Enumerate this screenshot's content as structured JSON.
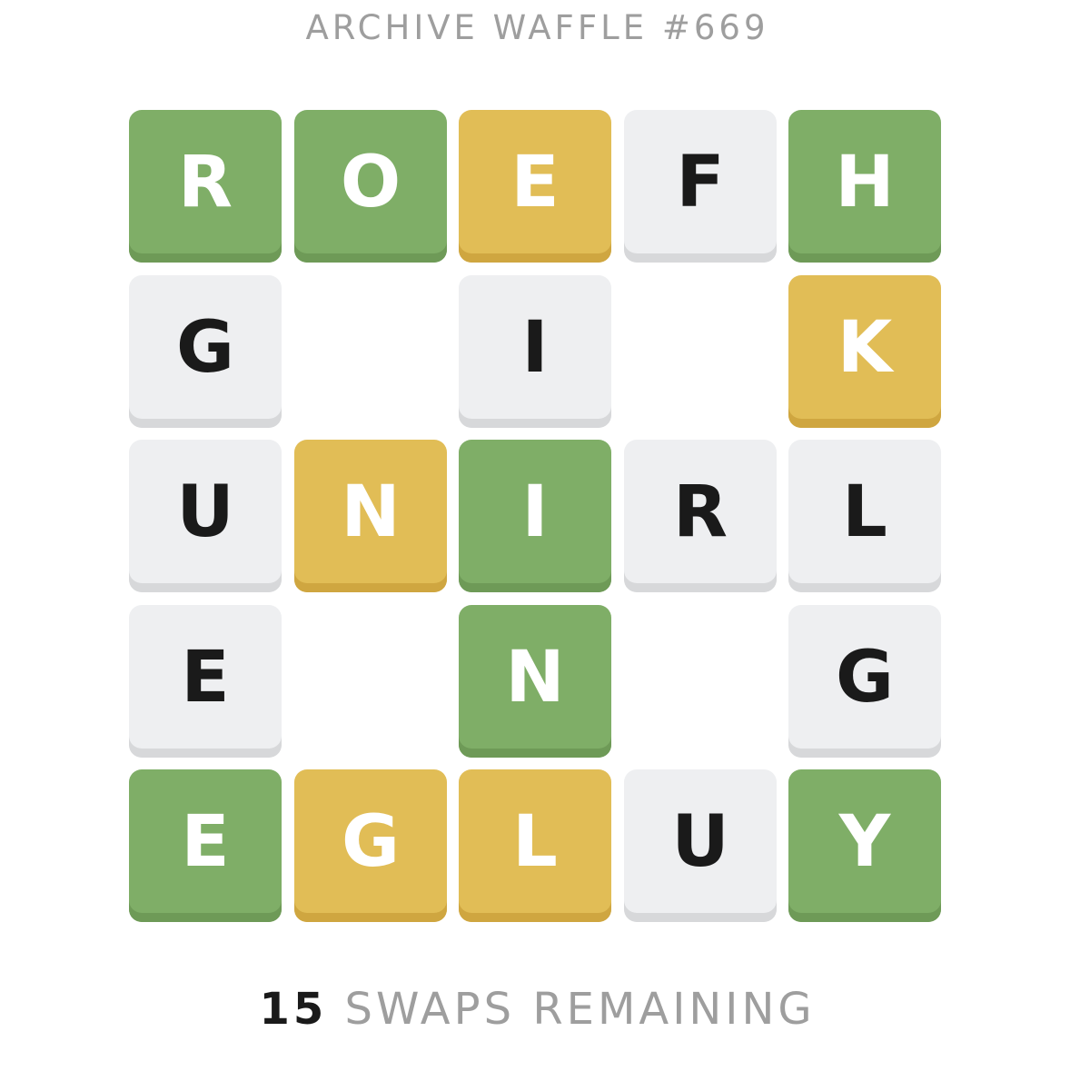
{
  "header": {
    "title": "ARCHIVE WAFFLE #669"
  },
  "colors": {
    "green": "#7fae67",
    "yellow": "#e1bd56",
    "grey": "#eeeff1",
    "dark_text": "#1a1a1a",
    "muted_text": "#9e9e9e"
  },
  "grid": {
    "rows": 5,
    "cols": 5,
    "tiles": [
      {
        "row": 0,
        "col": 0,
        "letter": "R",
        "state": "green"
      },
      {
        "row": 0,
        "col": 1,
        "letter": "O",
        "state": "green"
      },
      {
        "row": 0,
        "col": 2,
        "letter": "E",
        "state": "yellow"
      },
      {
        "row": 0,
        "col": 3,
        "letter": "F",
        "state": "empty"
      },
      {
        "row": 0,
        "col": 4,
        "letter": "H",
        "state": "green"
      },
      {
        "row": 1,
        "col": 0,
        "letter": "G",
        "state": "empty"
      },
      {
        "row": 1,
        "col": 2,
        "letter": "I",
        "state": "empty"
      },
      {
        "row": 1,
        "col": 4,
        "letter": "K",
        "state": "yellow"
      },
      {
        "row": 2,
        "col": 0,
        "letter": "U",
        "state": "empty"
      },
      {
        "row": 2,
        "col": 1,
        "letter": "N",
        "state": "yellow"
      },
      {
        "row": 2,
        "col": 2,
        "letter": "I",
        "state": "green"
      },
      {
        "row": 2,
        "col": 3,
        "letter": "R",
        "state": "empty"
      },
      {
        "row": 2,
        "col": 4,
        "letter": "L",
        "state": "empty"
      },
      {
        "row": 3,
        "col": 0,
        "letter": "E",
        "state": "empty"
      },
      {
        "row": 3,
        "col": 2,
        "letter": "N",
        "state": "green"
      },
      {
        "row": 3,
        "col": 4,
        "letter": "G",
        "state": "empty"
      },
      {
        "row": 4,
        "col": 0,
        "letter": "E",
        "state": "green"
      },
      {
        "row": 4,
        "col": 1,
        "letter": "G",
        "state": "yellow"
      },
      {
        "row": 4,
        "col": 2,
        "letter": "L",
        "state": "yellow"
      },
      {
        "row": 4,
        "col": 3,
        "letter": "U",
        "state": "empty"
      },
      {
        "row": 4,
        "col": 4,
        "letter": "Y",
        "state": "green"
      }
    ]
  },
  "footer": {
    "swaps_count": "15",
    "swaps_label": "SWAPS REMAINING"
  }
}
